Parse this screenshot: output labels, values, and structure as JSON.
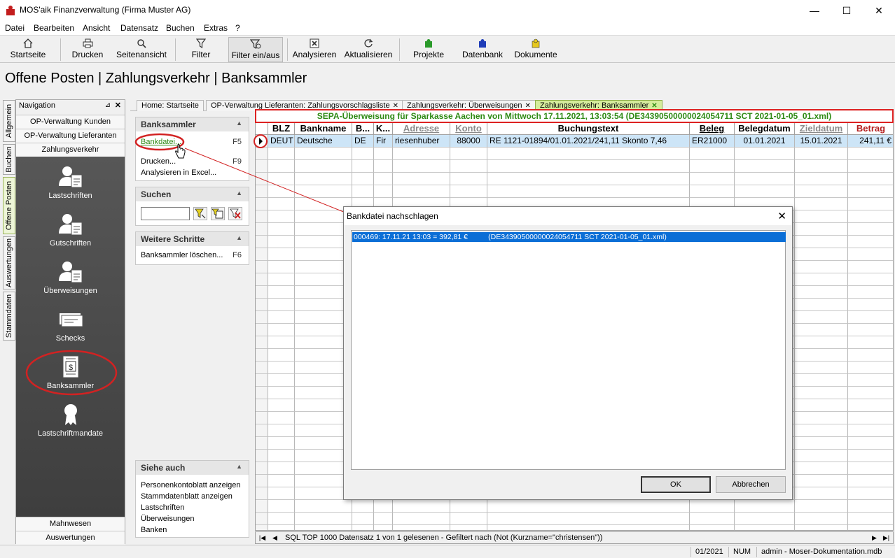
{
  "window": {
    "title": "MOS'aik Finanzverwaltung (Firma Muster AG)",
    "minimize": "—",
    "maximize": "☐",
    "close": "✕"
  },
  "menu": [
    "Datei",
    "Bearbeiten",
    "Ansicht",
    "Datensatz",
    "Buchen",
    "Extras",
    "?"
  ],
  "toolbar": {
    "startseite": "Startseite",
    "drucken": "Drucken",
    "seitenansicht": "Seitenansicht",
    "filter": "Filter",
    "filter_toggle": "Filter ein/aus",
    "analysieren": "Analysieren",
    "aktualisieren": "Aktualisieren",
    "projekte": "Projekte",
    "datenbank": "Datenbank",
    "dokumente": "Dokumente"
  },
  "page_title": "Offene Posten | Zahlungsverkehr | Banksammler",
  "side_tabs": [
    "Allgemein",
    "Buchen",
    "Offene Posten",
    "Auswertungen",
    "Stammdaten"
  ],
  "navigation": {
    "header": "Navigation",
    "pin": "⊿",
    "close": "✕",
    "groups_top": [
      "OP-Verwaltung Kunden",
      "OP-Verwaltung Lieferanten",
      "Zahlungsverkehr"
    ],
    "items": [
      "Lastschriften",
      "Gutschriften",
      "Überweisungen",
      "Schecks",
      "Banksammler",
      "Lastschriftmandate"
    ],
    "groups_bottom": [
      "Mahnwesen",
      "Auswertungen"
    ]
  },
  "tasks": {
    "banksammler": {
      "title": "Banksammler",
      "items": [
        {
          "label": "Bankdatei...",
          "key": "F5"
        },
        {
          "label": "Drucken...",
          "key": "F9"
        },
        {
          "label": "Analysieren in Excel...",
          "key": ""
        }
      ]
    },
    "suchen": {
      "title": "Suchen",
      "value": ""
    },
    "weitere": {
      "title": "Weitere Schritte",
      "items": [
        {
          "label": "Banksammler löschen...",
          "key": "F6"
        }
      ]
    },
    "siehe": {
      "title": "Siehe auch",
      "items": [
        "Personenkontoblatt anzeigen",
        "Stammdatenblatt anzeigen",
        "Lastschriften",
        "Überweisungen",
        "Banken"
      ]
    }
  },
  "doc_tabs": [
    {
      "label": "Home: Startseite",
      "closable": false
    },
    {
      "label": "OP-Verwaltung Lieferanten: Zahlungsvorschlagsliste",
      "closable": true
    },
    {
      "label": "Zahlungsverkehr: Überweisungen",
      "closable": true
    },
    {
      "label": "Zahlungsverkehr: Banksammler",
      "closable": true
    }
  ],
  "sepa_banner": "SEPA-Überweisung für Sparkasse Aachen von Mittwoch 17.11.2021, 13:03:54 (DE34390500000024054711 SCT 2021-01-05_01.xml)",
  "grid": {
    "columns": [
      "BLZ",
      "Bankname",
      "B...",
      "K...",
      "Adresse",
      "Konto",
      "Buchungstext",
      "Beleg",
      "Belegdatum",
      "Zieldatum",
      "Betrag"
    ],
    "rows": [
      [
        "DEUT",
        "Deutsche",
        "DE",
        "Fir",
        "riesenhuber",
        "88000",
        "RE 1121-01894/01.01.2021/241,11 Skonto 7,46",
        "ER21000",
        "01.01.2021",
        "15.01.2021",
        "241,11 €"
      ]
    ],
    "nav_text": "SQL TOP 1000 Datensatz 1 von 1 gelesenen - Gefiltert nach (Not (Kurzname=\"christensen\"))"
  },
  "dialog": {
    "title": "Bankdatei nachschlagen",
    "selected_item": "000469: 17.11.21 13:03 = 392,81 €          (DE34390500000024054711 SCT 2021-01-05_01.xml)",
    "ok": "OK",
    "cancel": "Abbrechen"
  },
  "status": {
    "period": "01/2021",
    "num": "NUM",
    "user": "admin - Moser-Dokumentation.mdb"
  },
  "colors": {
    "accent_green": "#2e8a14",
    "highlight_red": "#d22222",
    "selection_blue": "#0b6ed6",
    "row_select": "#cde5f7"
  }
}
